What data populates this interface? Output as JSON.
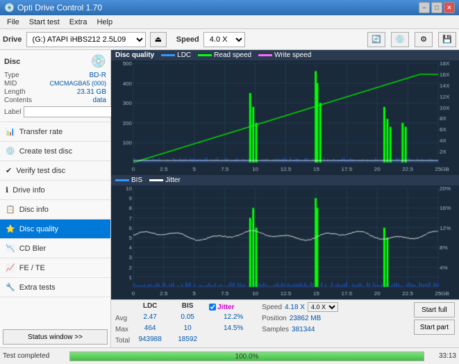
{
  "titlebar": {
    "title": "Opti Drive Control 1.70",
    "minimize": "−",
    "maximize": "□",
    "close": "✕"
  },
  "menu": {
    "items": [
      "File",
      "Start test",
      "Extra",
      "Help"
    ]
  },
  "drivebar": {
    "drive_label": "Drive",
    "drive_value": "(G:) ATAPI iHBS212  2.5L09",
    "speed_label": "Speed",
    "speed_value": "4.0 X"
  },
  "disc": {
    "type_key": "Type",
    "type_value": "BD-R",
    "mid_key": "MID",
    "mid_value": "CMCMAGBA5 (000)",
    "length_key": "Length",
    "length_value": "23.31 GB",
    "contents_key": "Contents",
    "contents_value": "data",
    "label_key": "Label"
  },
  "nav": {
    "items": [
      {
        "id": "transfer-rate",
        "label": "Transfer rate",
        "icon": "📊"
      },
      {
        "id": "create-test-disc",
        "label": "Create test disc",
        "icon": "💿"
      },
      {
        "id": "verify-test-disc",
        "label": "Verify test disc",
        "icon": "✔"
      },
      {
        "id": "drive-info",
        "label": "Drive info",
        "icon": "ℹ"
      },
      {
        "id": "disc-info",
        "label": "Disc info",
        "icon": "📋"
      },
      {
        "id": "disc-quality",
        "label": "Disc quality",
        "icon": "⭐",
        "active": true
      },
      {
        "id": "cd-bler",
        "label": "CD Bler",
        "icon": "📉"
      },
      {
        "id": "fe-te",
        "label": "FE / TE",
        "icon": "📈"
      },
      {
        "id": "extra-tests",
        "label": "Extra tests",
        "icon": "🔧"
      }
    ],
    "status_button": "Status window >>"
  },
  "chart": {
    "title": "Disc quality",
    "top": {
      "title_bar": "Disc quality",
      "legend": [
        {
          "color": "#3399ff",
          "label": "LDC"
        },
        {
          "color": "#00ff00",
          "label": "Read speed"
        },
        {
          "color": "#ff66ff",
          "label": "Write speed"
        }
      ],
      "y_max": 500,
      "y_right_max": 18,
      "x_max": 25.0
    },
    "bottom": {
      "legend": [
        {
          "color": "#3399ff",
          "label": "BIS"
        },
        {
          "color": "#ffffff",
          "label": "Jitter"
        }
      ],
      "y_max": 10,
      "y_right_max": 20,
      "x_max": 25.0
    }
  },
  "stats": {
    "columns": [
      "LDC",
      "BIS"
    ],
    "rows": [
      {
        "label": "Avg",
        "ldc": "2.47",
        "bis": "0.05"
      },
      {
        "label": "Max",
        "ldc": "464",
        "bis": "10"
      },
      {
        "label": "Total",
        "ldc": "943988",
        "bis": "18592"
      }
    ],
    "jitter": {
      "checked": true,
      "label": "Jitter",
      "avg": "12.2%",
      "max": "14.5%"
    },
    "speed": {
      "label": "Speed",
      "value": "4.18 X",
      "speed_select": "4.0 X",
      "position_label": "Position",
      "position_value": "23862 MB",
      "samples_label": "Samples",
      "samples_value": "381344"
    },
    "buttons": {
      "start_full": "Start full",
      "start_part": "Start part"
    }
  },
  "statusbar": {
    "status_text": "Test completed",
    "progress": 100.0,
    "progress_text": "100.0%",
    "time": "33:13"
  }
}
